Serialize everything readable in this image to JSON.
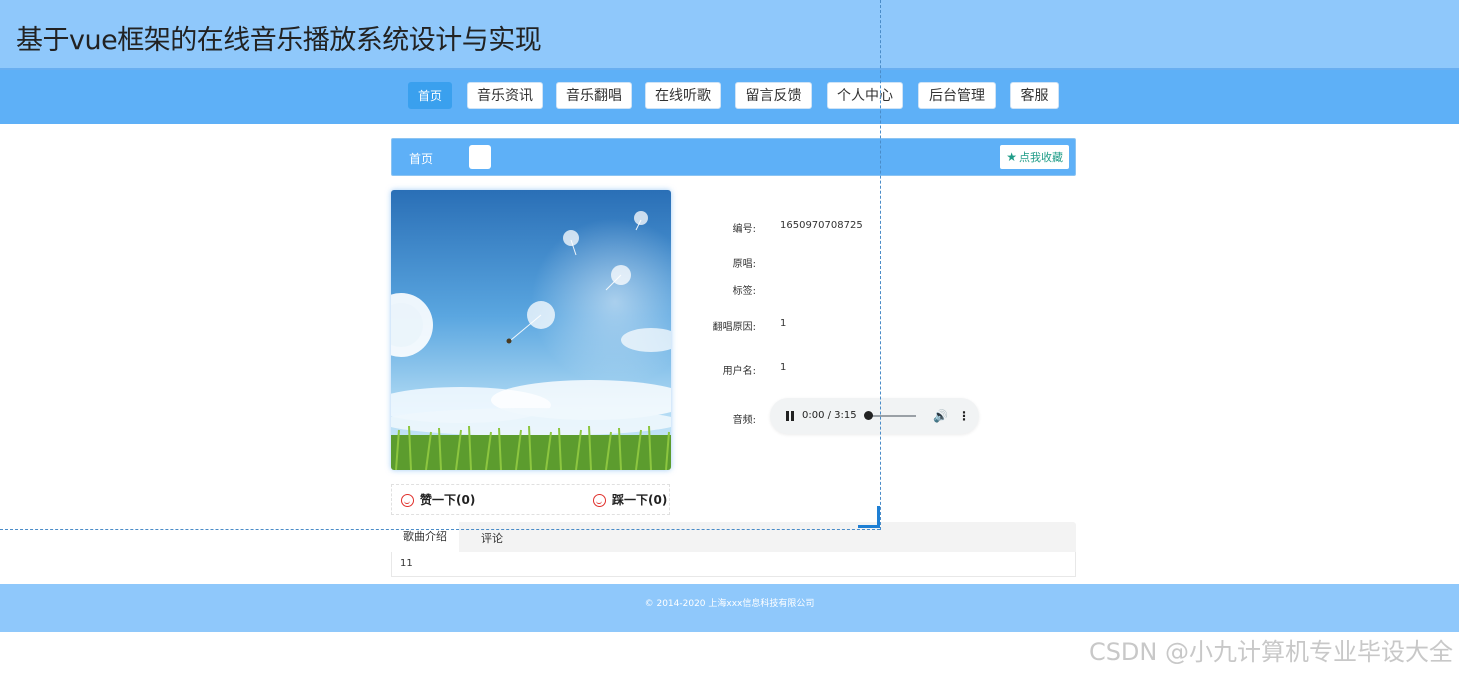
{
  "header": {
    "title": "基于vue框架的在线音乐播放系统设计与实现"
  },
  "nav": {
    "items": [
      {
        "label": "首页",
        "active": true
      },
      {
        "label": "音乐资讯"
      },
      {
        "label": "音乐翻唱"
      },
      {
        "label": "在线听歌"
      },
      {
        "label": "留言反馈"
      },
      {
        "label": "个人中心"
      },
      {
        "label": "后台管理"
      },
      {
        "label": "客服"
      }
    ]
  },
  "breadcrumb": {
    "home": "首页",
    "favorite_label": "点我收藏",
    "favorite_icon": "star-icon"
  },
  "details": {
    "number_label": "编号:",
    "number_value": "1650970708725",
    "original_label": "原唱:",
    "tag_label": "标签:",
    "reason_label": "翻唱原因:",
    "reason_value": "1",
    "username_label": "用户名:",
    "username_value": "1",
    "audio_label": "音频:"
  },
  "audio": {
    "time": "0:00 / 3:15",
    "progress": 0.0
  },
  "votes": {
    "like": "赞一下(0)",
    "dislike": "踩一下(0)"
  },
  "tabs": [
    {
      "label": "歌曲介绍",
      "active": true
    },
    {
      "label": "评论"
    }
  ],
  "tab_content": "11",
  "footer": {
    "copyright": "© 2014-2020 上海xxx信息科技有限公司"
  },
  "watermark": "CSDN @小九计算机专业毕设大全",
  "colors": {
    "header_bg": "#8fc8fb",
    "nav_bg": "#5eb0f7",
    "accent": "#3aa0ee",
    "fav": "#1f9c88"
  }
}
